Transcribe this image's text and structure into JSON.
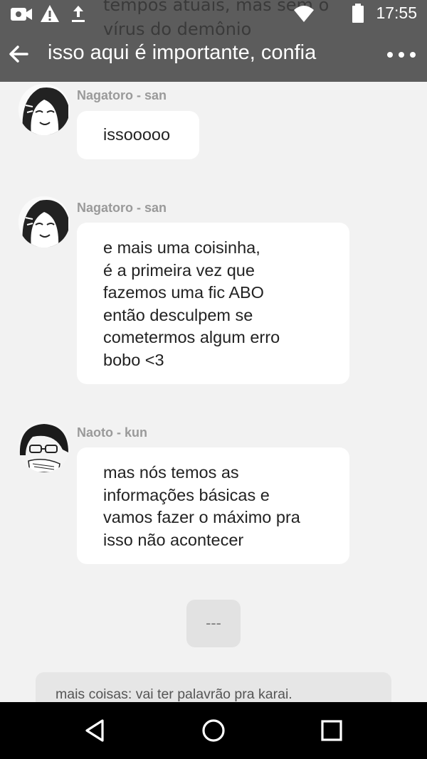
{
  "status_bar": {
    "time": "17:55",
    "icons": [
      "camera-icon",
      "warning-icon",
      "upload-icon",
      "wifi-icon",
      "battery-icon"
    ]
  },
  "background_text": [
    "tempos atuais, mas sem o",
    "vírus do demônio"
  ],
  "app_bar": {
    "title": "isso aqui é importante, confia",
    "back_icon": "arrow-back-icon",
    "more_icon": "more-horizontal-icon"
  },
  "messages": [
    {
      "sender": "Nagatoro - san",
      "lines": [
        "issooooo"
      ]
    },
    {
      "sender": "Nagatoro - san",
      "lines": [
        "e mais uma coisinha,",
        "é a primeira vez que",
        "fazemos uma fic ABO",
        "então desculpem se",
        "cometermos algum erro",
        "bobo <3"
      ]
    },
    {
      "sender": "Naoto - kun",
      "lines": [
        "mas nós temos as",
        "informações básicas e",
        "vamos fazer o máximo pra",
        "isso não acontecer"
      ]
    }
  ],
  "typing_indicator": "---",
  "preview_message": "mais coisas: vai ter palavrão pra karai.",
  "nav_bar": {
    "icons": [
      "back-triangle-icon",
      "home-circle-icon",
      "recents-square-icon"
    ]
  },
  "colors": {
    "app_bar": "#5c5c5c",
    "background": "#f2f2f2",
    "bubble": "#ffffff",
    "sender": "#9a9a9a"
  }
}
